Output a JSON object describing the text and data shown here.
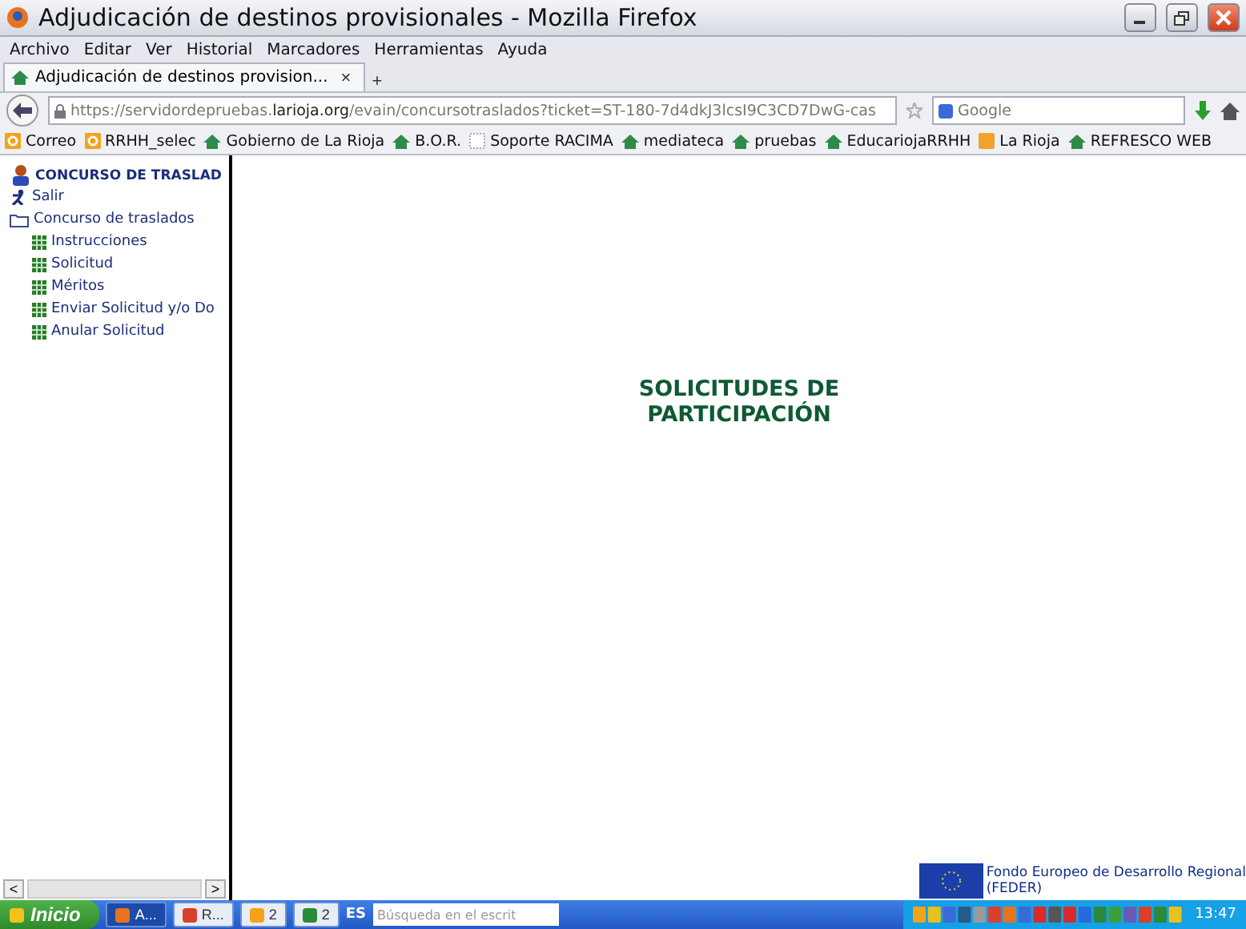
{
  "window": {
    "title": "Adjudicación de destinos provisionales - Mozilla Firefox"
  },
  "menu": [
    "Archivo",
    "Editar",
    "Ver",
    "Historial",
    "Marcadores",
    "Herramientas",
    "Ayuda"
  ],
  "tabs": [
    {
      "label": "Adjudicación de destinos provision...",
      "close": "×",
      "selected": true
    }
  ],
  "new_tab": "+",
  "url": {
    "prefix": "https://servidordepruebas.",
    "domain": "larioja.org",
    "rest": "/evain/concursotraslados?ticket=ST-180-7d4dkJ3lcsI9C3CD7DwG-cas"
  },
  "search": {
    "placeholder": "Google"
  },
  "bookmarks": [
    {
      "label": "Correo",
      "kind": "mail"
    },
    {
      "label": "RRHH_selec",
      "kind": "mail"
    },
    {
      "label": "Gobierno de La Rioja",
      "kind": "site"
    },
    {
      "label": "B.O.R.",
      "kind": "site"
    },
    {
      "label": "Soporte RACIMA",
      "kind": "blank"
    },
    {
      "label": "mediateca",
      "kind": "site"
    },
    {
      "label": "pruebas",
      "kind": "site"
    },
    {
      "label": "EducariojaRRHH",
      "kind": "site"
    },
    {
      "label": "La Rioja",
      "kind": "feed"
    },
    {
      "label": "REFRESCO WEB",
      "kind": "site"
    }
  ],
  "sidebar": {
    "header": "CONCURSO DE TRASLAD",
    "items": [
      {
        "label": "Salir",
        "kind": "exit"
      },
      {
        "label": "Concurso de traslados",
        "kind": "folder",
        "children": [
          {
            "label": "Instrucciones",
            "kind": "page"
          },
          {
            "label": "Solicitud",
            "kind": "page"
          },
          {
            "label": "Méritos",
            "kind": "page"
          },
          {
            "label": "Enviar Solicitud y/o Do",
            "kind": "page"
          },
          {
            "label": "Anular Solicitud",
            "kind": "page"
          }
        ]
      }
    ],
    "scroll_left": "<",
    "scroll_right": ">"
  },
  "main": {
    "heading_lines": [
      "SOLICITUDES DE",
      "PARTICIPACIÓN"
    ],
    "footer_lines": [
      "Fondo Europeo de Desarrollo Regional",
      "(FEDER)"
    ]
  },
  "taskbar": {
    "start": "Inicio",
    "buttons": [
      {
        "label": "A...",
        "kind": "firefox",
        "selected": true
      },
      {
        "label": "R...",
        "kind": "chrome",
        "selected": false
      },
      {
        "label": "2",
        "kind": "outlook",
        "selected": false
      },
      {
        "label": "2",
        "kind": "excel",
        "selected": false
      }
    ],
    "language": "ES",
    "search_placeholder": "Búsqueda en el escrit",
    "time": "13:47"
  }
}
